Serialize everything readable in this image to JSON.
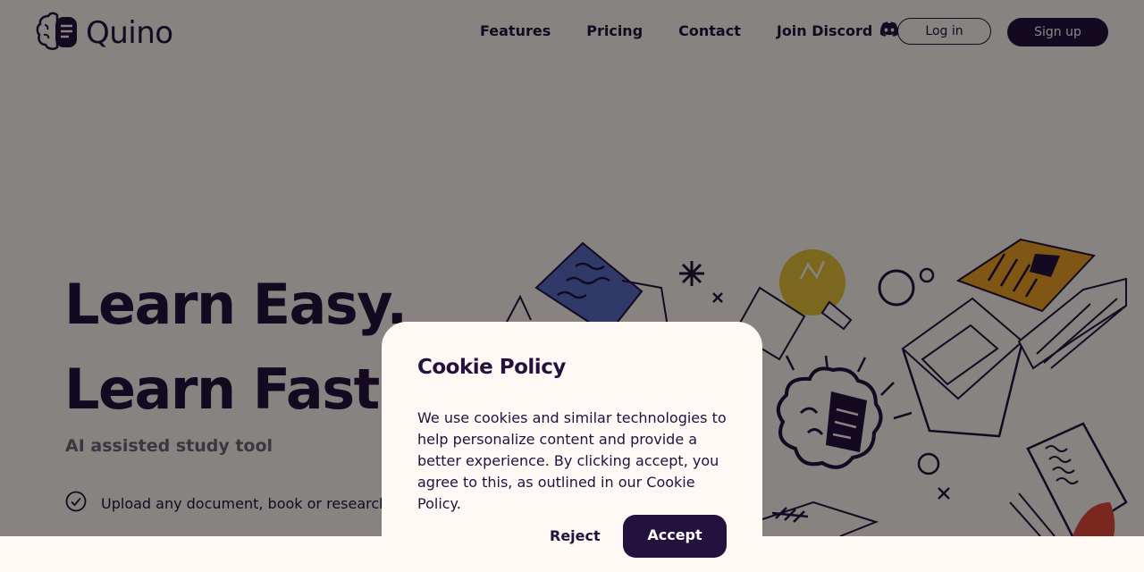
{
  "brand": {
    "name": "Quino"
  },
  "nav": {
    "items": [
      {
        "label": "Features"
      },
      {
        "label": "Pricing"
      },
      {
        "label": "Contact"
      },
      {
        "label": "Join Discord",
        "icon": "discord-icon"
      }
    ],
    "login_label": "Log in",
    "signup_label": "Sign up"
  },
  "hero": {
    "line1": "Learn Easy.",
    "line2": "Learn Fast.",
    "subtitle": "AI assisted study tool",
    "features": [
      {
        "text": "Upload any document, book or research paper",
        "icon": "check-circle-icon"
      }
    ]
  },
  "cookie": {
    "title": "Cookie Policy",
    "body": "We use cookies and similar technologies to help personalize content and provide a better experience. By clicking accept, you agree to this, as outlined in our Cookie Policy.",
    "reject_label": "Reject",
    "accept_label": "Accept"
  },
  "colors": {
    "primary": "#24113e",
    "background": "#fff8f4",
    "accent_blue": "#5a6fc6",
    "accent_yellow": "#e8c23a",
    "accent_orange": "#f0a224",
    "accent_red": "#e64a3c"
  }
}
